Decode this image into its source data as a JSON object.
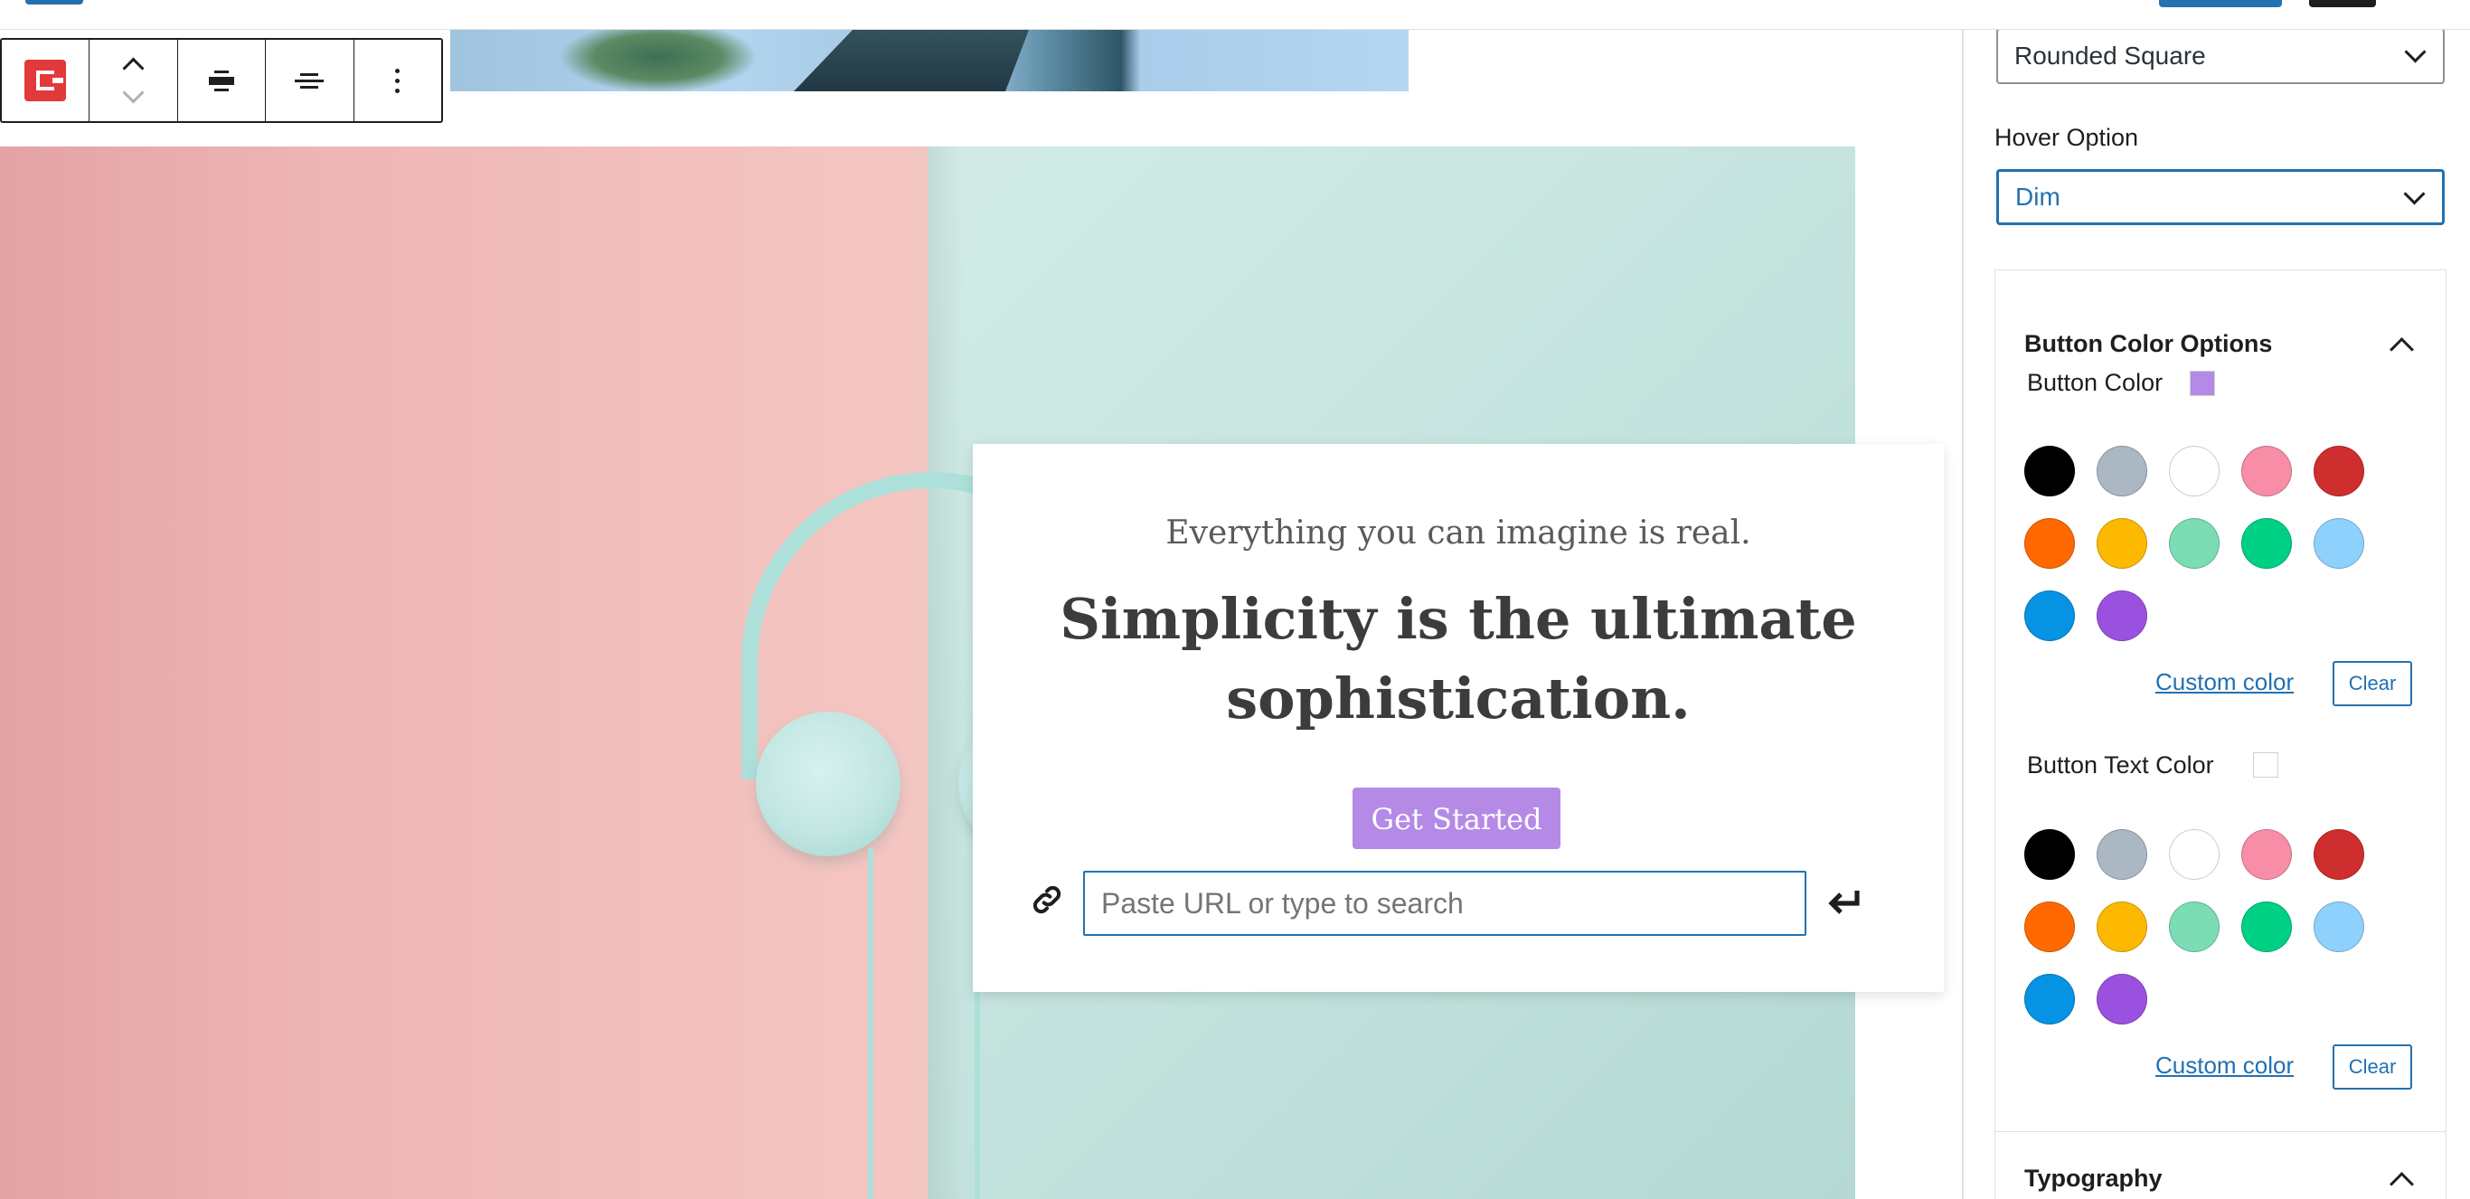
{
  "canvas": {
    "card": {
      "tagline": "Everything you can imagine is real.",
      "headline": "Simplicity is the ultimate sophistication.",
      "button_label": "Get Started",
      "url_placeholder": "Paste URL or type to search"
    }
  },
  "sidebar": {
    "shape_select": {
      "value": "Rounded Square"
    },
    "hover_option": {
      "label": "Hover Option",
      "value": "Dim"
    },
    "button_color_panel": {
      "title": "Button Color Options",
      "button_color": {
        "label": "Button Color",
        "current": "#b58ae6",
        "custom_color_label": "Custom color",
        "clear_label": "Clear"
      },
      "button_text_color": {
        "label": "Button Text Color",
        "current": "#ffffff",
        "custom_color_label": "Custom color",
        "clear_label": "Clear"
      },
      "palette": [
        "#000000",
        "#abb8c3",
        "#ffffff",
        "#f78da7",
        "#cf2e2e",
        "#ff6900",
        "#fcb900",
        "#7bdcb5",
        "#00d084",
        "#8ed1fc",
        "#0693e3",
        "#9b51e0"
      ]
    },
    "typography_panel": {
      "title": "Typography"
    }
  },
  "colors": {
    "accent": "#2271b1",
    "block_badge": "#e2393b"
  },
  "icons": [
    "block-type-icon",
    "chevron-up-icon",
    "chevron-down-icon",
    "align-center-icon",
    "text-align-icon",
    "more-options-icon",
    "link-icon",
    "enter-icon",
    "dropdown-arrow-icon",
    "panel-collapse-icon"
  ]
}
